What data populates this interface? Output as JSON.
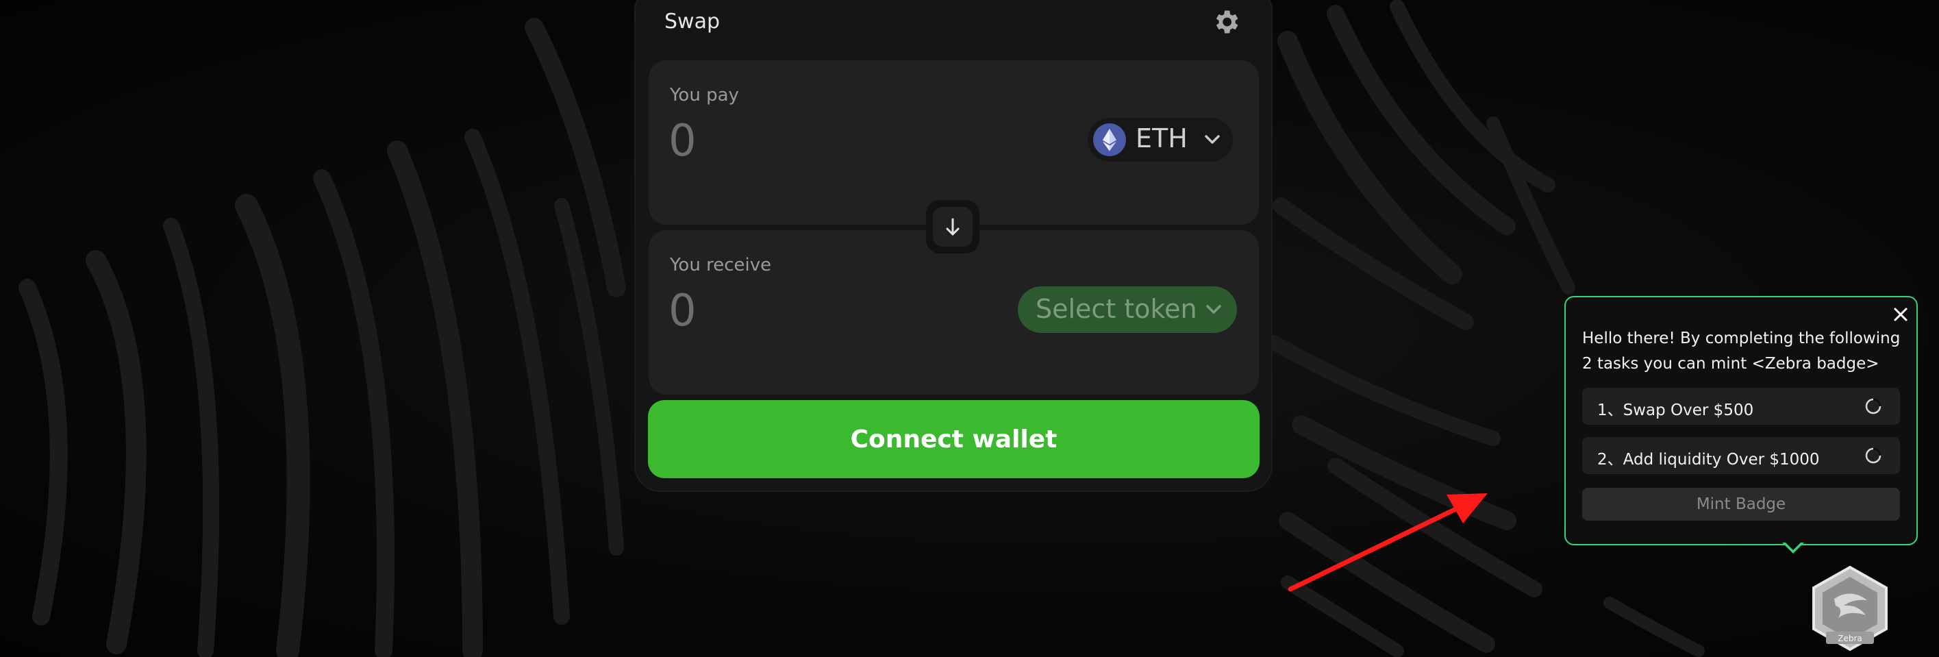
{
  "swap": {
    "title": "Swap",
    "settings_icon": "gear-icon",
    "pay": {
      "label": "You pay",
      "amount_placeholder": "0",
      "token_symbol": "ETH",
      "token_icon": "ethereum-icon"
    },
    "flip_icon": "arrow-down-icon",
    "receive": {
      "label": "You receive",
      "amount_placeholder": "0",
      "select_label": "Select token"
    },
    "connect_label": "Connect wallet"
  },
  "popup": {
    "message": "Hello there! By completing the following 2 tasks you can mint <Zebra badge>",
    "tasks": [
      {
        "label": "1、Swap Over $500",
        "status_icon": "pending-circle-icon"
      },
      {
        "label": "2、Add liquidity Over $1000",
        "status_icon": "pending-circle-icon"
      }
    ],
    "mint_label": "Mint Badge",
    "close_icon": "close-icon"
  },
  "badge": {
    "label": "Zebra"
  },
  "colors": {
    "accent_green": "#3bb92f",
    "popup_border": "#35d37a",
    "annotation_arrow": "#ff1a1a",
    "eth_blue": "#4b5aa7"
  }
}
